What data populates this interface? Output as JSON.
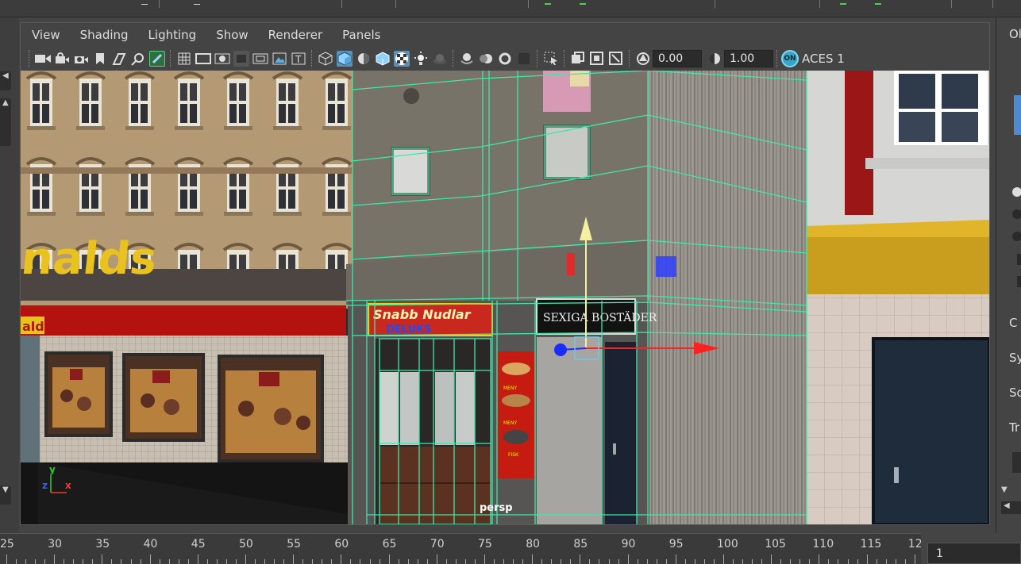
{
  "menubar": {
    "items": [
      "View",
      "Shading",
      "Lighting",
      "Show",
      "Renderer",
      "Panels"
    ]
  },
  "toolbar": {
    "exposure_value": "0.00",
    "gamma_value": "1.00",
    "color_mgmt_badge": "ON",
    "color_space_label": "ACES 1"
  },
  "viewport": {
    "camera_label": "persp",
    "axis": {
      "x": "x",
      "y": "y",
      "z": "z"
    },
    "signs": {
      "noodles": "Snabb Nudlar",
      "noodles_sub": "DELUKS",
      "housing": "SEXIGA BOSTÄDER",
      "brand_big": "nalds",
      "brand_small": "alds"
    },
    "colors": {
      "wire": "#3de8a8",
      "move_y": "#f4f0a0",
      "move_x": "#ff2020",
      "move_z": "#1a2cff"
    }
  },
  "rightpanel": {
    "labels": [
      "Ol",
      "C",
      "Sy",
      "Sc",
      "Tr"
    ]
  },
  "timeline": {
    "ticks": [
      "25",
      "30",
      "35",
      "40",
      "45",
      "50",
      "55",
      "60",
      "65",
      "70",
      "75",
      "80",
      "85",
      "90",
      "95",
      "100",
      "105",
      "110",
      "115",
      "12"
    ],
    "current_frame": "1"
  }
}
